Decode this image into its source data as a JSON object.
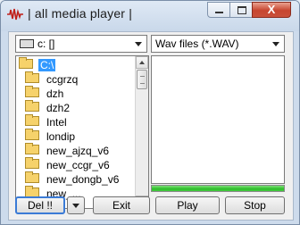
{
  "window": {
    "title": "| all media player |",
    "app_icon": "waveform-icon",
    "close_glyph": "X"
  },
  "drive_combo": {
    "value": "c: []",
    "icon": "drive-icon"
  },
  "filter_combo": {
    "value": "Wav files (*.WAV)"
  },
  "folder_list": {
    "items": [
      {
        "label": "C:\\",
        "icon": "open-folder-icon",
        "selected": true
      },
      {
        "label": "ccgrzq",
        "icon": "folder-icon"
      },
      {
        "label": "dzh",
        "icon": "folder-icon"
      },
      {
        "label": "dzh2",
        "icon": "folder-icon"
      },
      {
        "label": "Intel",
        "icon": "folder-icon"
      },
      {
        "label": "londip",
        "icon": "folder-icon"
      },
      {
        "label": "new_ajzq_v6",
        "icon": "folder-icon"
      },
      {
        "label": "new_ccgr_v6",
        "icon": "folder-icon"
      },
      {
        "label": "new_dongb_v6",
        "icon": "folder-icon"
      },
      {
        "label": "new_...",
        "icon": "folder-icon"
      }
    ]
  },
  "progress": {
    "value": 1.0,
    "color": "#2ebd2a"
  },
  "buttons": {
    "del": "Del !!",
    "exit": "Exit",
    "play": "Play",
    "stop": "Stop"
  }
}
